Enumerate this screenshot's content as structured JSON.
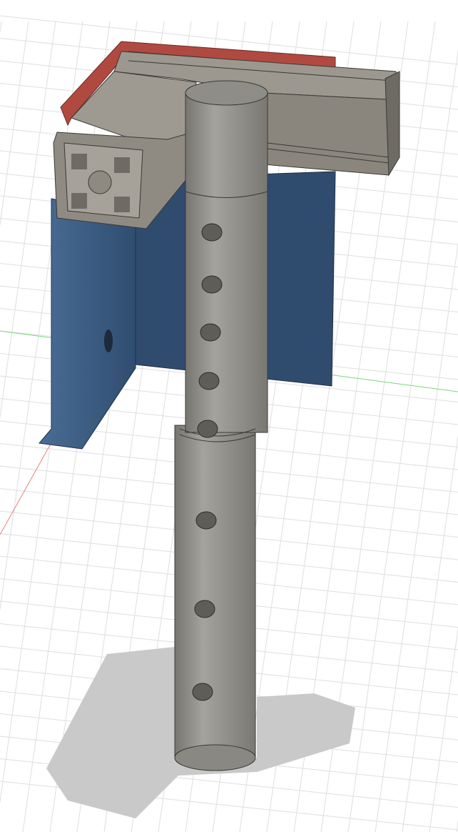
{
  "viewport": {
    "colors": {
      "background": "#ffffff",
      "grid": "#dcdcdc",
      "x_axis": "#e06060",
      "y_axis": "#60d060",
      "bracket": "#3d5f86",
      "bracket_dark": "#2c4868",
      "extrusion": "#8e8a82",
      "extrusion_light": "#a9a59d",
      "extrusion_dark": "#6e6b65",
      "gasket": "#b04a40",
      "tube": "#8c8a84",
      "tube_light": "#a3a19b",
      "shadow": "#c8c8c8",
      "hole": "#5a5853"
    }
  }
}
